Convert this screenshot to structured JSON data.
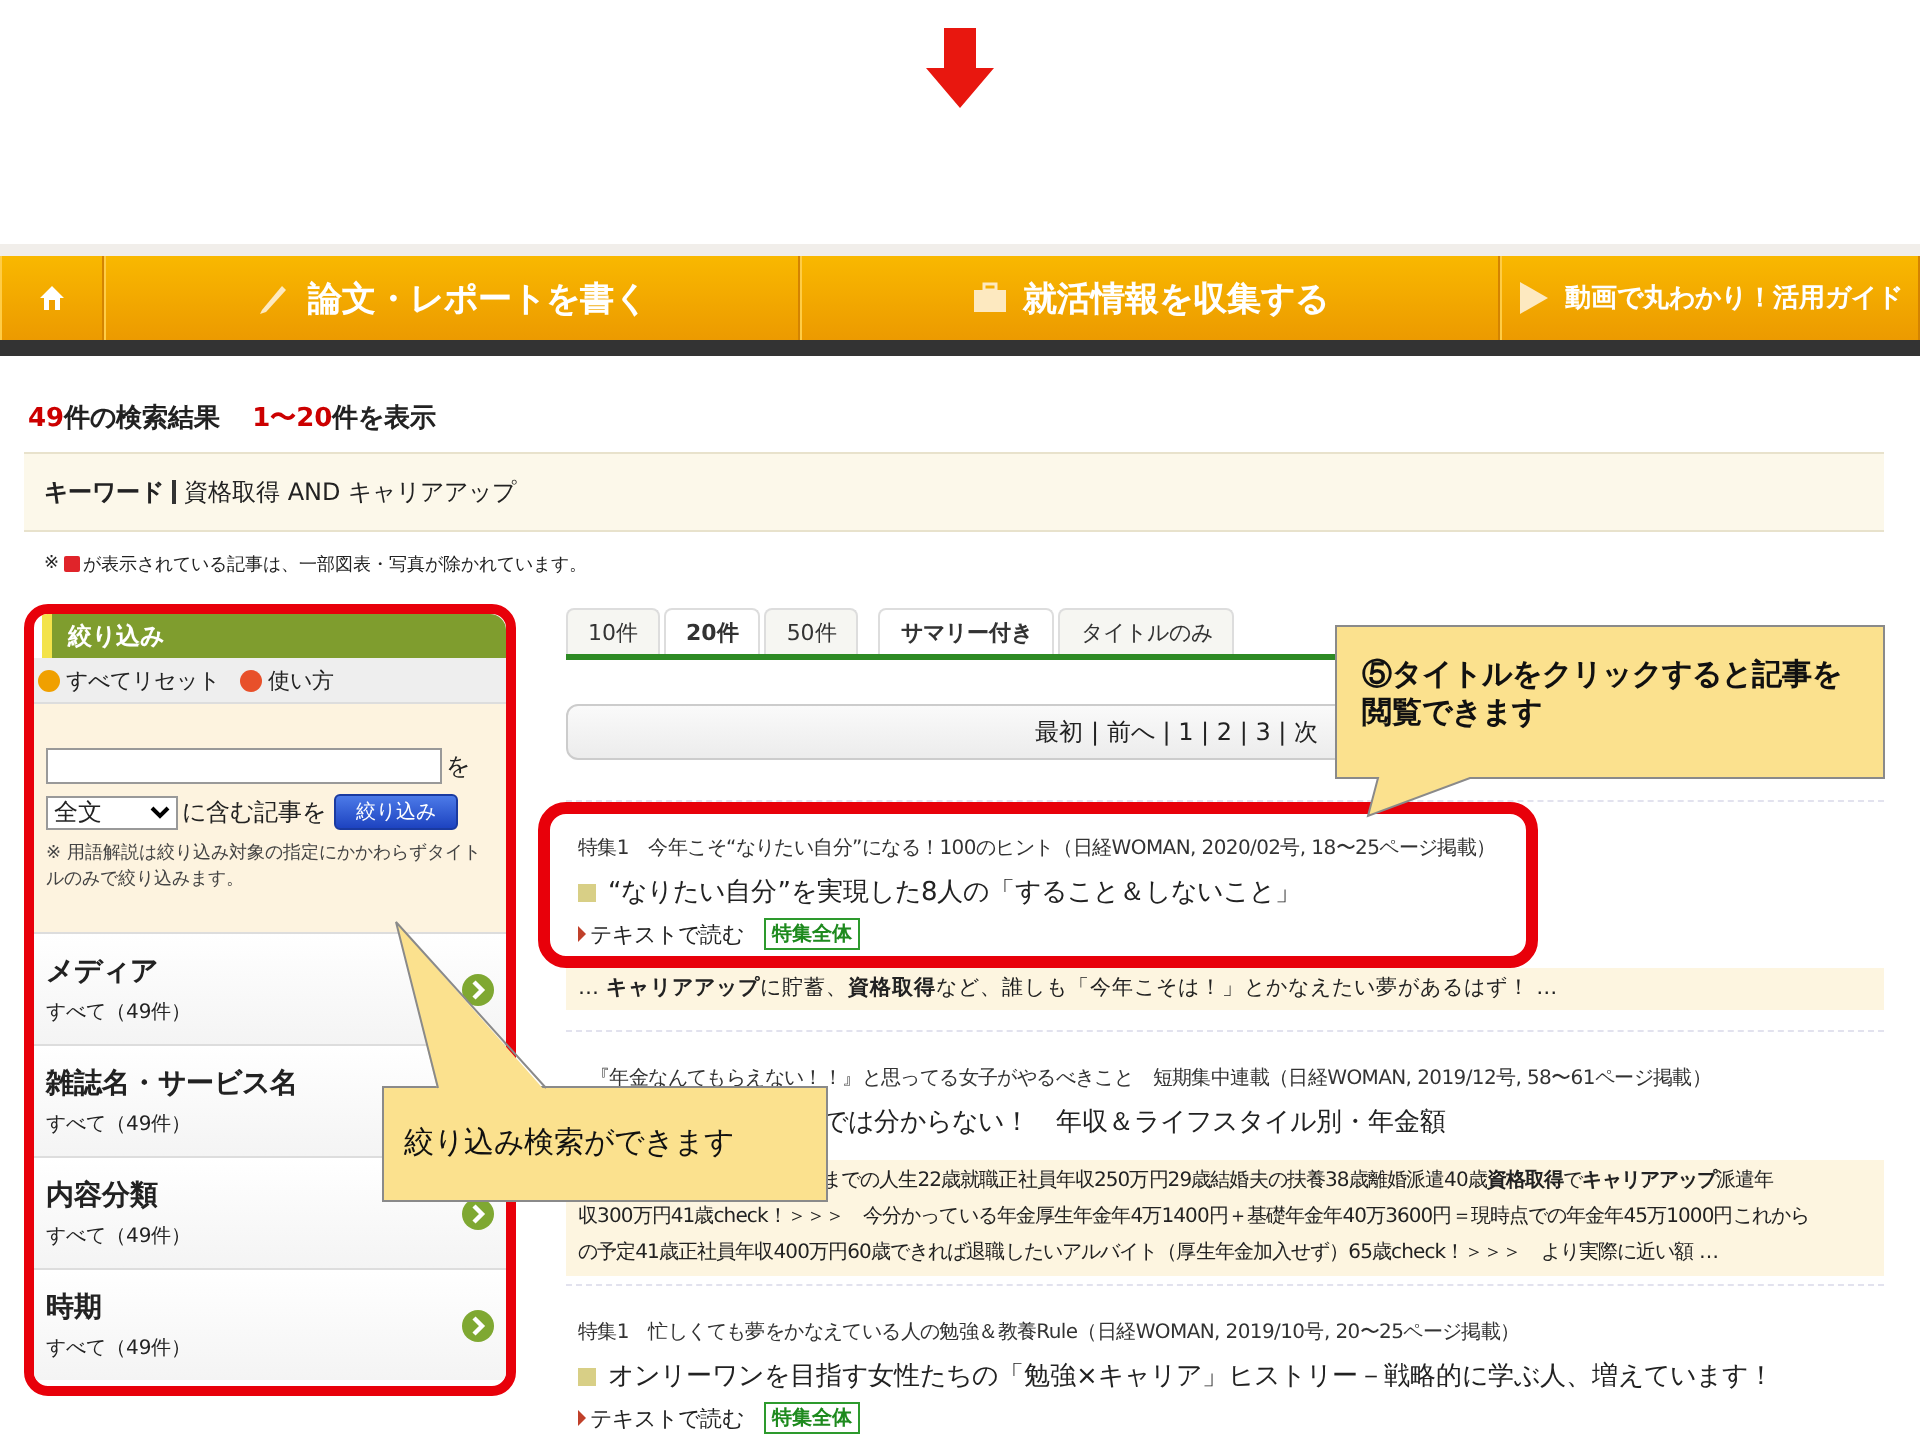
{
  "nav": [
    {
      "kind": "home"
    },
    {
      "kind": "pen",
      "label": "論文・レポートを書く"
    },
    {
      "kind": "briefcase",
      "label": "就活情報を収集する"
    },
    {
      "kind": "play",
      "label": "動画で丸わかり！活用ガイド"
    }
  ],
  "results_header": {
    "count": "49",
    "count_suffix": "件の検索結果",
    "range": "1〜20",
    "range_suffix": "件を表示"
  },
  "keyword": {
    "label": "キーワード",
    "value": "資格取得 AND キャリアアップ"
  },
  "note": {
    "prefix": "※",
    "text": "が表示されている記事は、一部図表・写真が除かれています。"
  },
  "filter": {
    "highlighted": true,
    "title": "絞り込み",
    "reset": "すべてリセット",
    "help": "使い方",
    "input_suffix": "を",
    "select_value": "全文",
    "select_suffix": "に含む記事を",
    "button": "絞り込み",
    "hint": "※ 用語解説は絞り込み対象の指定にかかわらずタイトルのみで絞り込みます。",
    "facets": [
      {
        "name": "メディア",
        "value": "すべて（49件）",
        "arrow": true
      },
      {
        "name": "雑誌名・サービス名",
        "value": "すべて（49件）"
      },
      {
        "name": "内容分類",
        "value": "すべて（49件）",
        "arrow": true
      },
      {
        "name": "時期",
        "value": "すべて（49件）",
        "arrow": true
      }
    ]
  },
  "count_tabs": [
    {
      "label": "10件",
      "selected": false
    },
    {
      "label": "20件",
      "selected": true
    },
    {
      "label": "50件",
      "selected": false
    }
  ],
  "view_tabs": [
    {
      "label": "サマリー付き",
      "selected": true
    },
    {
      "label": "タイトルのみ",
      "selected": false
    }
  ],
  "pagination": "最初 | 前へ | 1 | 2 | 3 | 次",
  "articles": [
    {
      "highlighted": true,
      "meta": "特集1　今年こそ“なりたい自分”になる！100のヒント（日経WOMAN, 2020/02号, 18〜25ページ掲載）",
      "title": "“なりたい自分”を実現した8人の「すること＆しないこと」",
      "read_link": "テキストで読む",
      "tag": "特集全体",
      "summary": "… **キャリアアップ**に貯蓄、**資格取得**など、誰しも「今年こそは！」とかなえたい夢があるはず！ …"
    },
    {
      "highlighted": false,
      "meta": "『年金なんてもらえない！！』と思ってる女子がやるべきこと　短期集中連載（日経WOMAN, 2019/12号, 58〜61ページ掲載）",
      "title": "では分からない！　年収＆ライフスタイル別・年金額",
      "summary_lines": [
        "までの人生22歳就職正社員年収250万円29歳結婚夫の扶養38歳離婚派遣40歳**資格取得**で**キャリアアップ**派遣年",
        "収300万円41歳check！＞＞＞　今分かっている年金厚生年金年4万1400円＋基礎年金年40万3600円＝現時点での年金年45万1000円これから",
        "の予定41歳正社員年収400万円60歳できれば退職したいアルバイト（厚生年金加入せず）65歳check！＞＞＞　より実際に近い額 …"
      ]
    },
    {
      "highlighted": false,
      "meta": "特集1　忙しくても夢をかなえている人の勉強＆教養Rule（日経WOMAN, 2019/10号, 20〜25ページ掲載）",
      "title": "オンリーワンを目指す女性たちの「勉強×キャリア」ヒストリー－戦略的に学ぶ人、増えています！",
      "read_link": "テキストで読む",
      "tag": "特集全体"
    }
  ],
  "callouts": [
    {
      "text": "⑤タイトルをクリックすると記事を閲覧できます"
    },
    {
      "text": "絞り込み検索ができます"
    }
  ]
}
